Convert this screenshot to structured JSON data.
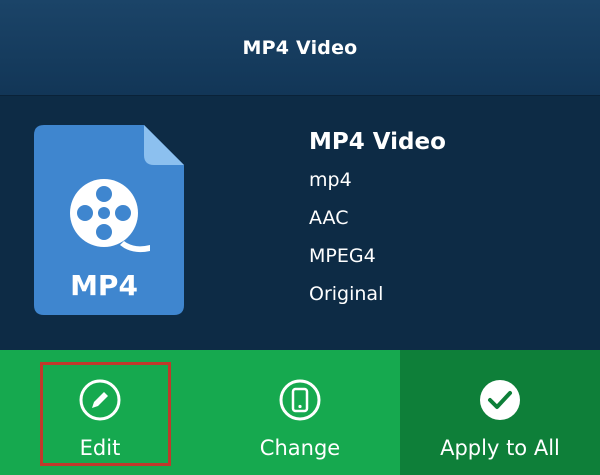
{
  "header": {
    "title": "MP4 Video"
  },
  "format_info": {
    "icon_label": "MP4",
    "name": "MP4 Video",
    "extension": "mp4",
    "audio_codec": "AAC",
    "video_codec": "MPEG4",
    "resolution": "Original"
  },
  "actions": {
    "edit_label": "Edit",
    "change_label": "Change",
    "apply_all_label": "Apply to All"
  },
  "colors": {
    "header": "#1b4468",
    "panel": "#0d2b45",
    "icon_blue": "#3f86cf",
    "green": "#16a94f",
    "dark_green": "#0e7f39",
    "highlight": "#c0392b"
  }
}
